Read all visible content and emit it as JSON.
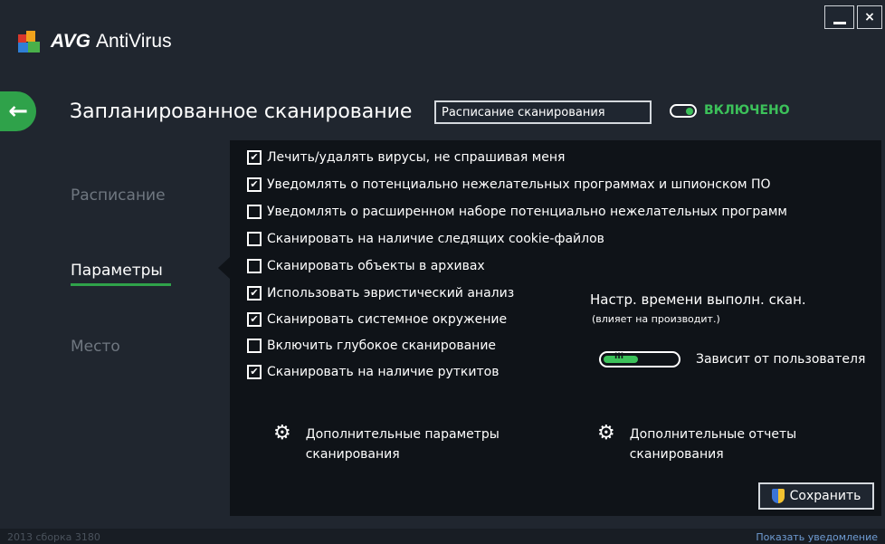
{
  "app": {
    "brand": "AVG",
    "product": "AntiVirus",
    "minimize_glyph": "_",
    "close_glyph": "×"
  },
  "header": {
    "back_icon": "←",
    "title": "Запланированное сканирование",
    "name_value": "Расписание сканирования",
    "toggle_label": "ВКЛЮЧЕНО"
  },
  "sidebar": {
    "items": [
      {
        "label": "Расписание"
      },
      {
        "label": "Параметры"
      },
      {
        "label": "Место"
      }
    ]
  },
  "options": [
    {
      "label": "Лечить/удалять вирусы, не спрашивая меня",
      "checked": true
    },
    {
      "label": "Уведомлять о потенциально нежелательных программах и шпионском ПО",
      "checked": true
    },
    {
      "label": "Уведомлять о расширенном наборе потенциально нежелательных программ",
      "checked": false
    },
    {
      "label": "Сканировать на наличие следящих cookie-файлов",
      "checked": false
    },
    {
      "label": "Сканировать объекты в архивах",
      "checked": false
    },
    {
      "label": "Использовать эвристический анализ",
      "checked": true
    },
    {
      "label": "Сканировать системное окружение",
      "checked": true
    },
    {
      "label": "Включить глубокое сканирование",
      "checked": false
    },
    {
      "label": "Сканировать на наличие руткитов",
      "checked": true
    }
  ],
  "speed": {
    "title": "Настр. времени выполн. скан.",
    "subtitle": "(влияет на производит.)",
    "value_label": "Зависит от пользователя",
    "level": 0.45
  },
  "links": {
    "advanced_line1": "Дополнительные параметры",
    "advanced_line2": "сканирования",
    "reports_line1": "Дополнительные отчеты",
    "reports_line2": "сканирования"
  },
  "buttons": {
    "save_label": "Сохранить"
  },
  "footer": {
    "build": "2013  сборка 3180",
    "notify": "Показать уведомление"
  },
  "colors": {
    "accent_green": "#3cc15a",
    "panel_bg": "#0f1318",
    "window_bg": "#20262f"
  }
}
